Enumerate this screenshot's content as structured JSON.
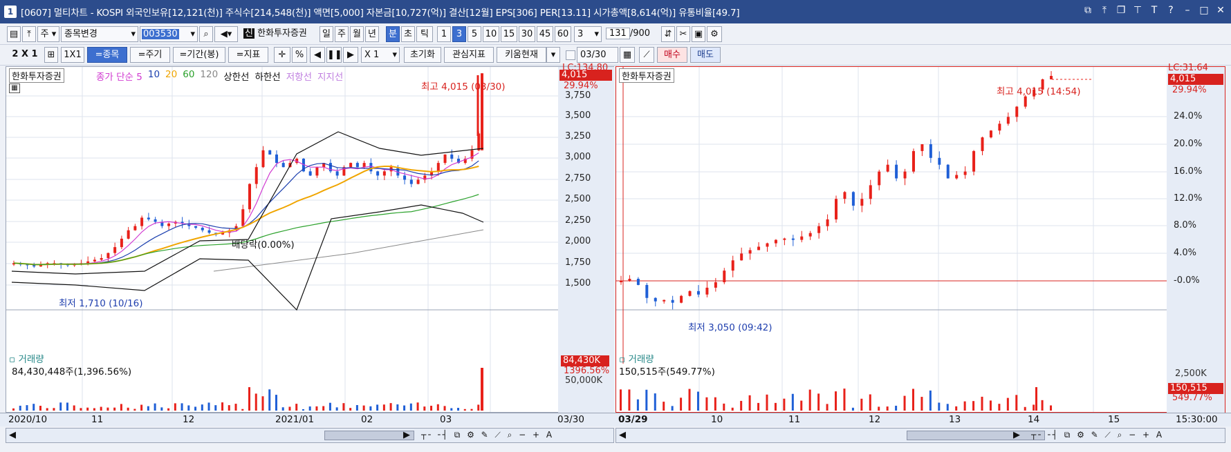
{
  "title": {
    "icon": "1",
    "text": "[0607] 멀티차트 - KOSPI 외국인보유[12,121(천)] 주식수[214,548(천)] 액면[5,000] 자본금[10,727(억)] 결산[12월] EPS[306] PER[13.11] 시가총액[8,614(억)] 유통비율[49.7]"
  },
  "toolbar1": {
    "stock_type": "주",
    "change_stock": "종목변경",
    "code": "003530",
    "company": "한화투자증권",
    "periods": [
      "일",
      "주",
      "월",
      "년",
      "분",
      "초",
      "틱"
    ],
    "intervals": [
      "1",
      "3",
      "5",
      "10",
      "15",
      "30",
      "45",
      "60"
    ],
    "interval_value": "3",
    "count": "131",
    "count_max": "/900"
  },
  "toolbar2": {
    "layout": "2 X 1",
    "onebyone": "1X1",
    "btn_stock": "=종목",
    "btn_period": "=주기",
    "btn_range": "=기간(봉)",
    "btn_indicator": "=지표",
    "multiplier": "X 1",
    "reset": "초기화",
    "watch": "관심지표",
    "kiwoom": "키움현재",
    "date": "03/30",
    "buy": "매수",
    "sell": "매도"
  },
  "left_chart": {
    "name": "한화투자증권",
    "legend": [
      "종가 단순 5",
      "10",
      "20",
      "60",
      "120",
      "상한선",
      "하한선",
      "저항선",
      "지지선"
    ],
    "high_label": "최고 4,015 (03/30)",
    "low_label": "최저 1,710 (10/16)",
    "dividend_label": "배당락(0.00%)",
    "lc": "LC:134.80",
    "last_price": "4,015",
    "last_pct": "29.94%",
    "yticks": [
      "3,750",
      "3,500",
      "3,250",
      "3,000",
      "2,750",
      "2,500",
      "2,250",
      "2,000",
      "1,750",
      "1,500"
    ],
    "xticks": [
      "2020/10",
      "11",
      "12",
      "2021/01",
      "02",
      "03"
    ],
    "x_last": "03/30",
    "volume_title": "거래량",
    "volume_value": "84,430,448주(1,396.56%)",
    "volume_box": "84,430K",
    "volume_pct": "1396.56%",
    "volume_tick": "50,000K"
  },
  "right_chart": {
    "name": "한화투자증권",
    "high_label": "최고 4,015 (14:54)",
    "low_label": "최저 3,050 (09:42)",
    "lc": "LC:31.64",
    "last_price": "4,015",
    "last_pct": "29.94%",
    "yticks": [
      "24.0%",
      "20.0%",
      "16.0%",
      "12.0%",
      "8.0%",
      "4.0%",
      "-0.0%"
    ],
    "xticks": [
      "03/29",
      "10",
      "11",
      "12",
      "13",
      "14",
      "15"
    ],
    "x_last": "15:30:00",
    "volume_title": "거래량",
    "volume_value": "150,515주(549.77%)",
    "volume_box": "150,515",
    "volume_pct": "549.77%",
    "volume_tick": "2,500K"
  },
  "colors": {
    "up": "#e8211a",
    "down": "#1f5fd6",
    "title_bg": "#2c4c8c",
    "ma5": "#d13bd1",
    "ma10": "#1b3fae",
    "ma20": "#f0a500",
    "ma60": "#2aa12a",
    "ma120": "#888888"
  }
}
